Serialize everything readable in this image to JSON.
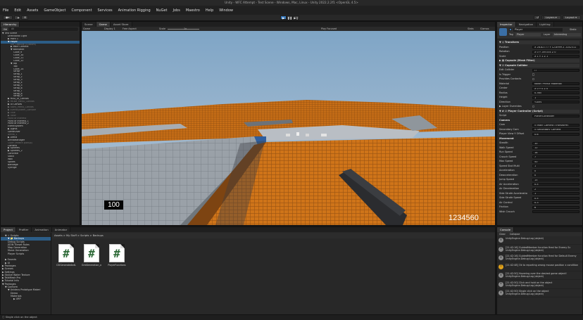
{
  "window": {
    "title": "Unity - WFC Attempt - Test Scene - Windows, Mac, Linux - Unity 2022.2.2f1 <OpenGL 4.5>"
  },
  "menu": [
    "File",
    "Edit",
    "Assets",
    "GameObject",
    "Component",
    "Services",
    "Animation Rigging",
    "NuGet",
    "Jobs",
    "Maestro",
    "Help",
    "Window"
  ],
  "toolbar": {
    "layers_label": "Layers",
    "layout_label": "Layout"
  },
  "hierarchy": {
    "tab": "Hierarchy",
    "search_placeholder": "All",
    "rows": [
      {
        "text": "▼ Test Scene",
        "indent": 0,
        "sel": false,
        "dim": false
      },
      {
        "text": "Directional Light",
        "indent": 2,
        "sel": false,
        "dim": false
      },
      {
        "text": "▶ Point 1",
        "indent": 2,
        "sel": false,
        "dim": false
      },
      {
        "text": "▼ Player",
        "indent": 2,
        "sel": true,
        "dim": false
      },
      {
        "text": "SM_Capsule (Custom)",
        "indent": 3,
        "sel": false,
        "dim": true
      },
      {
        "text": "▶ Main Camera",
        "indent": 3,
        "sel": false,
        "dim": false
      },
      {
        "text": "▼ Backpack",
        "indent": 3,
        "sel": false,
        "dim": false
      },
      {
        "text": "Cube_9",
        "indent": 4,
        "sel": false,
        "dim": false
      },
      {
        "text": "Cube_10",
        "indent": 4,
        "sel": false,
        "dim": false
      },
      {
        "text": "Cube_11",
        "indent": 4,
        "sel": false,
        "dim": false
      },
      {
        "text": "Cube_12",
        "indent": 4,
        "sel": false,
        "dim": false
      },
      {
        "text": "▼ Top",
        "indent": 3,
        "sel": false,
        "dim": false
      },
      {
        "text": "Top",
        "indent": 4,
        "sel": false,
        "dim": false
      },
      {
        "text": "Cube_14",
        "indent": 4,
        "sel": false,
        "dim": false
      },
      {
        "text": "Strap",
        "indent": 4,
        "sel": false,
        "dim": false
      },
      {
        "text": "Strap_1",
        "indent": 4,
        "sel": false,
        "dim": false
      },
      {
        "text": "Strap_2",
        "indent": 4,
        "sel": false,
        "dim": false
      },
      {
        "text": "Strap_3",
        "indent": 4,
        "sel": false,
        "dim": false
      },
      {
        "text": "Strap_4",
        "indent": 4,
        "sel": false,
        "dim": false
      },
      {
        "text": "Strap_5",
        "indent": 4,
        "sel": false,
        "dim": false
      },
      {
        "text": "Strap_6",
        "indent": 4,
        "sel": false,
        "dim": false
      },
      {
        "text": "Strap_7",
        "indent": 4,
        "sel": false,
        "dim": false
      },
      {
        "text": "Strap_8",
        "indent": 4,
        "sel": false,
        "dim": false
      },
      {
        "text": "Strap_9",
        "indent": 4,
        "sel": false,
        "dim": false
      },
      {
        "text": "▶ HUD_UI_Canvas",
        "indent": 2,
        "sel": false,
        "dim": false
      },
      {
        "text": "▶ Pause_Menu_Canvas",
        "indent": 2,
        "sel": false,
        "dim": true
      },
      {
        "text": "▶ UI Canvas",
        "indent": 2,
        "sel": false,
        "dim": false
      },
      {
        "text": "▶ Story_Menu_Canvas",
        "indent": 2,
        "sel": false,
        "dim": true
      },
      {
        "text": "▶ EventSystem_Console",
        "indent": 2,
        "sel": false,
        "dim": true
      },
      {
        "text": "▶ Title",
        "indent": 2,
        "sel": false,
        "dim": true
      },
      {
        "text": "▶ Tutor",
        "indent": 2,
        "sel": false,
        "dim": true
      },
      {
        "text": "Point of interest",
        "indent": 2,
        "sel": false,
        "dim": true
      },
      {
        "text": "Point of interest_1",
        "indent": 2,
        "sel": false,
        "dim": false
      },
      {
        "text": "Point of interest_2",
        "indent": 2,
        "sel": false,
        "dim": false
      },
      {
        "text": "EventSystem",
        "indent": 2,
        "sel": false,
        "dim": false
      },
      {
        "text": "▶ Lights",
        "indent": 2,
        "sel": false,
        "dim": false
      },
      {
        "text": "GameOver",
        "indent": 2,
        "sel": false,
        "dim": false
      },
      {
        "text": "Arena_1",
        "indent": 2,
        "sel": false,
        "dim": true
      },
      {
        "text": "▶ Arena",
        "indent": 2,
        "sel": false,
        "dim": false
      },
      {
        "text": "ArenaManager",
        "indent": 2,
        "sel": false,
        "dim": false
      },
      {
        "text": "Cube (Health pickup)",
        "indent": 2,
        "sel": false,
        "dim": true
      },
      {
        "text": "Camera",
        "indent": 2,
        "sel": false,
        "dim": false
      },
      {
        "text": "▶ Spheres",
        "indent": 2,
        "sel": false,
        "dim": false
      },
      {
        "text": "▶ Spheres_2",
        "indent": 2,
        "sel": false,
        "dim": false
      },
      {
        "text": "Concrete",
        "indent": 2,
        "sel": false,
        "dim": false
      },
      {
        "text": "Stack",
        "indent": 2,
        "sel": false,
        "dim": false
      },
      {
        "text": "Wall",
        "indent": 2,
        "sel": false,
        "dim": false
      },
      {
        "text": "Spikes",
        "indent": 2,
        "sel": false,
        "dim": false
      },
      {
        "text": "Bandage",
        "indent": 2,
        "sel": false,
        "dim": false
      },
      {
        "text": "Syringe",
        "indent": 2,
        "sel": false,
        "dim": false
      }
    ]
  },
  "scene_tabs": [
    {
      "label": "Scene",
      "active": false
    },
    {
      "label": "Game",
      "active": true
    },
    {
      "label": "Asset Store",
      "active": false
    }
  ],
  "game_toolbar": {
    "display": "Game",
    "display_num": "Display 1",
    "aspect": "Free Aspect",
    "scale_label": "Scale",
    "scale_value": "1x",
    "play_focused": "Play Focused",
    "stats": "Stats",
    "gizmos": "Gizmos"
  },
  "hud": {
    "health": "100",
    "score": "1234560"
  },
  "inspector": {
    "tabs": [
      {
        "label": "Inspector",
        "active": true
      },
      {
        "label": "Navigation",
        "active": false
      },
      {
        "label": "Lighting",
        "active": false
      }
    ],
    "object_name": "Player",
    "static_label": "Static",
    "tag_label": "Tag",
    "tag_value": "Player",
    "layer_label": "Layer",
    "layer_value": "Interesting",
    "rows": [
      {
        "type": "header",
        "label": "▼ ⊹ Transform",
        "value": ""
      },
      {
        "type": "field",
        "label": "Position",
        "value": "X  28.82777   Y  12.8999   Z  -4.82311"
      },
      {
        "type": "field",
        "label": "Rotation",
        "value": "X  0         Y  -89.534   Z  0"
      },
      {
        "type": "field",
        "label": "Scale",
        "value": "X  1          Y  1         Z  1"
      },
      {
        "type": "header",
        "label": "▶ ▦ Capsule (Mesh Filter)",
        "value": ""
      },
      {
        "type": "header",
        "label": "▼ ☑ Capsule Collider",
        "value": ""
      },
      {
        "type": "field",
        "label": "Edit Collider",
        "value": "⬡"
      },
      {
        "type": "plain",
        "label": "Is Trigger",
        "value": ""
      },
      {
        "type": "plain",
        "label": "Provides Contacts",
        "value": ""
      },
      {
        "type": "field",
        "label": "Material",
        "value": "None (Physic Material)"
      },
      {
        "type": "field",
        "label": "Center",
        "value": "X 0     Y 0     Z 0"
      },
      {
        "type": "field",
        "label": "Radius",
        "value": "0.365"
      },
      {
        "type": "field",
        "label": "Height",
        "value": "1"
      },
      {
        "type": "field",
        "label": "Direction",
        "value": "Y-Axis"
      },
      {
        "type": "plain",
        "label": "▶ Layer Overrides",
        "value": ""
      },
      {
        "type": "header",
        "label": "▼ # ☑ Player Controller (Script)",
        "value": ""
      },
      {
        "type": "field",
        "label": "Script",
        "value": "PlayerController"
      },
      {
        "type": "section",
        "label": "Camera",
        "value": ""
      },
      {
        "type": "field",
        "label": "Cam",
        "value": "⊙ Main Camera (Transform)"
      },
      {
        "type": "field",
        "label": "Secondary Cam",
        "value": "⊙ Secondary Camera"
      },
      {
        "type": "field",
        "label": "Player View Y Offset",
        "value": "0.6"
      },
      {
        "type": "section",
        "label": "Movement",
        "value": ""
      },
      {
        "type": "field",
        "label": "Stealth",
        "value": "10"
      },
      {
        "type": "field",
        "label": "Walk Speed",
        "value": "12"
      },
      {
        "type": "field",
        "label": "Run Speed",
        "value": "18"
      },
      {
        "type": "field",
        "label": "Crouch Speed",
        "value": "7"
      },
      {
        "type": "field",
        "label": "Max Speed",
        "value": "50"
      },
      {
        "type": "field",
        "label": "Speed Stat Multi",
        "value": "1"
      },
      {
        "type": "field",
        "label": "Acceleration",
        "value": "0"
      },
      {
        "type": "field",
        "label": "Deacceleration",
        "value": "0"
      },
      {
        "type": "field",
        "label": "Jump Speed",
        "value": "15"
      },
      {
        "type": "field",
        "label": "Air Acceleration",
        "value": "0.5"
      },
      {
        "type": "field",
        "label": "Air Deceleration",
        "value": "2"
      },
      {
        "type": "field",
        "label": "Side Strafe Acceleratio",
        "value": "1"
      },
      {
        "type": "field",
        "label": "Side Strafe Speed",
        "value": "0.5"
      },
      {
        "type": "field",
        "label": "Air Control",
        "value": "0.3"
      },
      {
        "type": "field",
        "label": "Friction",
        "value": "6"
      },
      {
        "type": "field",
        "label": "Wish Crouch",
        "value": ""
      }
    ]
  },
  "bottom_tabs": [
    {
      "label": "Project",
      "active": true
    },
    {
      "label": "Profiler",
      "active": false
    },
    {
      "label": "Animation",
      "active": false
    },
    {
      "label": "Animator",
      "active": false
    }
  ],
  "project": {
    "breadcrumb": "Assets  >  My Stuff  >  Scripts  >  Backups",
    "tree": [
      {
        "text": "▼ ☆ Scripts",
        "indent": 1
      },
      {
        "text": "▼ 📁 Backups",
        "indent": 2
      },
      {
        "text": "Debug Scripts",
        "indent": 2
      },
      {
        "text": "JSON Tileset Rules",
        "indent": 2
      },
      {
        "text": "Map Generation",
        "indent": 2
      },
      {
        "text": "Music Generation",
        "indent": 2
      },
      {
        "text": "Player Scripts",
        "indent": 2
      },
      {
        "text": "",
        "indent": 1
      },
      {
        "text": "▶ Sounds",
        "indent": 1
      },
      {
        "text": "▶ UI",
        "indent": 1
      },
      {
        "text": "▶ Packages",
        "indent": 0
      },
      {
        "text": "▶ Scenes",
        "indent": 0
      },
      {
        "text": "▶ Settings",
        "indent": 0
      },
      {
        "text": "▶ Stylize Water Texture",
        "indent": 0
      },
      {
        "text": "▶ TextMesh Pro",
        "indent": 0
      },
      {
        "text": "▶ Tutorial Info",
        "indent": 0
      },
      {
        "text": "▼ Packages",
        "indent": 0
      },
      {
        "text": "▼ Conform",
        "indent": 1
      },
      {
        "text": "▼ Unidecs Prototype Materi",
        "indent": 2
      },
      {
        "text": "Demo",
        "indent": 3
      },
      {
        "text": "Materials",
        "indent": 3
      },
      {
        "text": "▶ URP",
        "indent": 4
      }
    ],
    "files": [
      {
        "name": "CSIGenerateAndLo..."
      },
      {
        "name": "GridGeneration_old"
      },
      {
        "name": "PlayerFunctions"
      }
    ]
  },
  "console": {
    "tab": "Console",
    "toolbar": [
      "Clear",
      "Collapse"
    ],
    "items": [
      {
        "type": "info",
        "line1": "UnityEngine.Debug:Log (object)",
        "line2": ""
      },
      {
        "type": "info",
        "line1": "[21:42:16] GuidedMember function fired for Enemy Sc",
        "line2": "UnityEngine.Debug:Log (object)"
      },
      {
        "type": "info",
        "line1": "[21:42:16] GuidedMember function fired for Default Enemy",
        "line2": "UnityEngine.Debug:Log (object)"
      },
      {
        "type": "warn",
        "line1": "[21:42:48] Ok to reporting wrong mouse position x condition",
        "line2": ""
      },
      {
        "type": "info",
        "line1": "[21:42:50] Hovering over the desired game object!",
        "line2": "UnityEngine.Debug:Log (object)"
      },
      {
        "type": "info",
        "line1": "[21:42:50] Click and hold on the object",
        "line2": "UnityEngine.Debug:Log (object)"
      },
      {
        "type": "info",
        "line1": "[21:42:50] Single click on the object",
        "line2": "UnityEngine.Debug:Log (object)"
      }
    ]
  },
  "statusbar": {
    "message": "Single click on the object"
  }
}
